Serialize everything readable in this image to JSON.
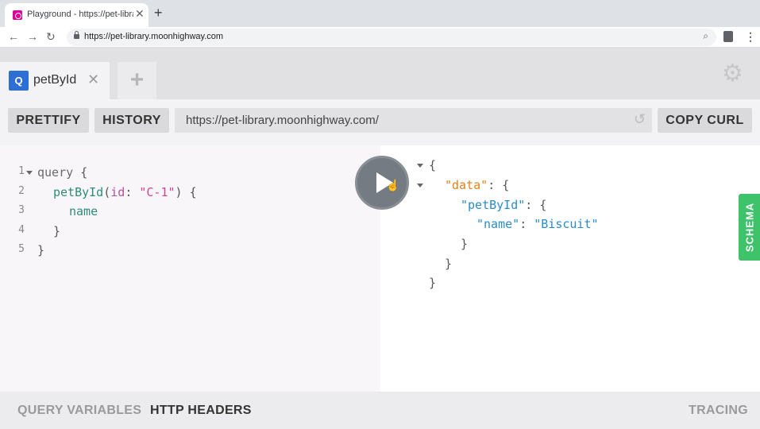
{
  "browser": {
    "tab_title": "Playground - https://pet-library.moonhighway.com",
    "new_tab_symbol": "+",
    "address": "https://pet-library.moonhighway.com"
  },
  "playground": {
    "query_tab": {
      "badge": "Q",
      "name": "petById",
      "close_symbol": "✕"
    },
    "add_tab_symbol": "+",
    "buttons": {
      "prettify": "PRETTIFY",
      "history": "HISTORY",
      "copy_curl": "COPY CURL"
    },
    "endpoint": "https://pet-library.moonhighway.com/",
    "schema_label": "SCHEMA",
    "bottom": {
      "query_variables": "QUERY VARIABLES",
      "http_headers": "HTTP HEADERS",
      "tracing": "TRACING"
    },
    "query": {
      "line_numbers": [
        "1",
        "2",
        "3",
        "4",
        "5"
      ],
      "l1_keyword": "query",
      "l1_brace": "{",
      "l2_field": "petById",
      "l2_open": "(",
      "l2_arg": "id",
      "l2_colon": ": ",
      "l2_value": "\"C-1\"",
      "l2_close": ") {",
      "l3_field": "name",
      "l4": "}",
      "l5": "}"
    },
    "result": {
      "l1": "{",
      "l2_key": "\"data\"",
      "l2_rest": ": {",
      "l3_key": "\"petById\"",
      "l3_rest": ": {",
      "l4_key": "\"name\"",
      "l4_colon": ": ",
      "l4_value": "\"Biscuit\"",
      "l5": "}",
      "l6": "}",
      "l7": "}"
    }
  },
  "colors": {
    "accent_blue": "#2e6fd6",
    "schema_green": "#3ec26a",
    "graphql_pink": "#e10098"
  }
}
